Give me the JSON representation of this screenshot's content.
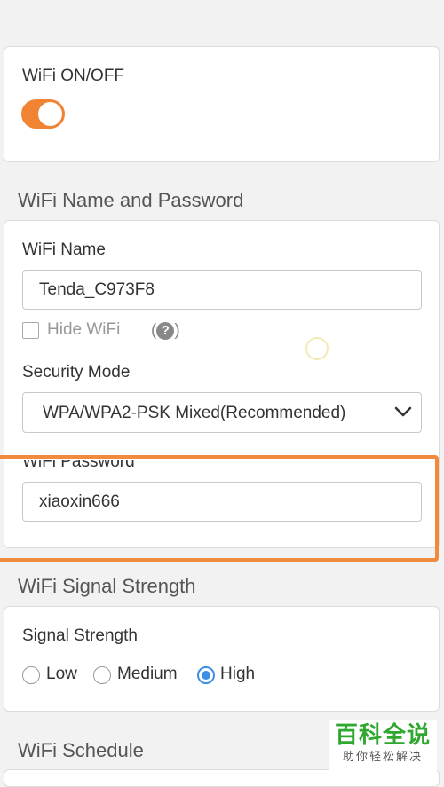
{
  "wifi_toggle": {
    "label": "WiFi ON/OFF",
    "state": "on",
    "accent": "#f08432"
  },
  "name_password_section": {
    "title": "WiFi Name and Password",
    "wifi_name_label": "WiFi Name",
    "wifi_name_value": "Tenda_C973F8",
    "hide_wifi_label": "Hide WiFi",
    "hide_wifi_checked": false,
    "help_icon": "question-circle-icon",
    "security_mode_label": "Security Mode",
    "security_mode_value": "WPA/WPA2-PSK Mixed(Recommended)",
    "wifi_password_label": "WiFi Password",
    "wifi_password_value": "xiaoxin666"
  },
  "signal_section": {
    "title": "WiFi Signal Strength",
    "label": "Signal Strength",
    "options": [
      "Low",
      "Medium",
      "High"
    ],
    "selected": "High",
    "accent": "#3c8ee6"
  },
  "schedule_section": {
    "title": "WiFi Schedule"
  },
  "highlight_color": "#f08a3c",
  "watermark": {
    "title": "百科全说",
    "subtitle": "助你轻松解决"
  }
}
